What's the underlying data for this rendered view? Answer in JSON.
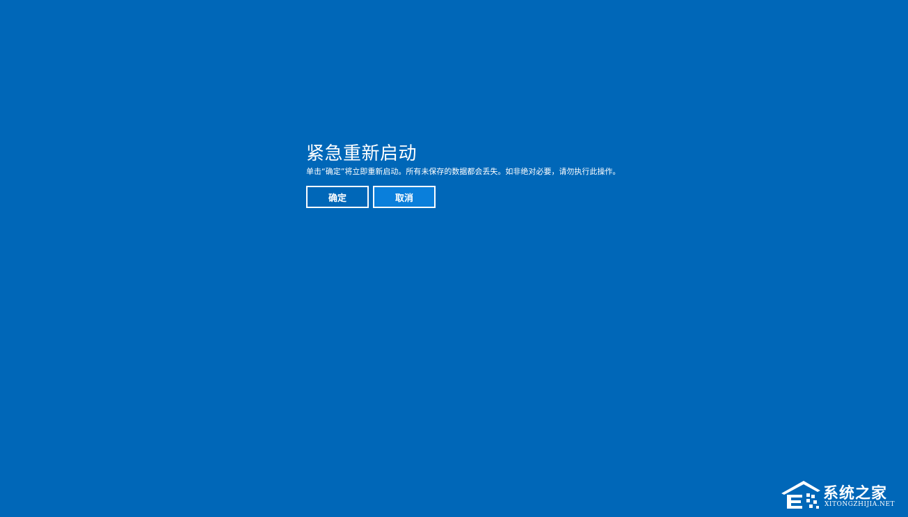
{
  "dialog": {
    "title": "紧急重新启动",
    "message": "单击“确定”将立即重新启动。所有未保存的数据都会丢失。如非绝对必要，请勿执行此操作。",
    "ok_label": "确定",
    "cancel_label": "取消"
  },
  "watermark": {
    "name": "系统之家",
    "domain": "XITONGZHIJIA.NET",
    "logo_icon": "house-logo-icon"
  },
  "colors": {
    "background": "#0067b8",
    "cancel_button": "#0a7fdb",
    "text": "#ffffff"
  }
}
